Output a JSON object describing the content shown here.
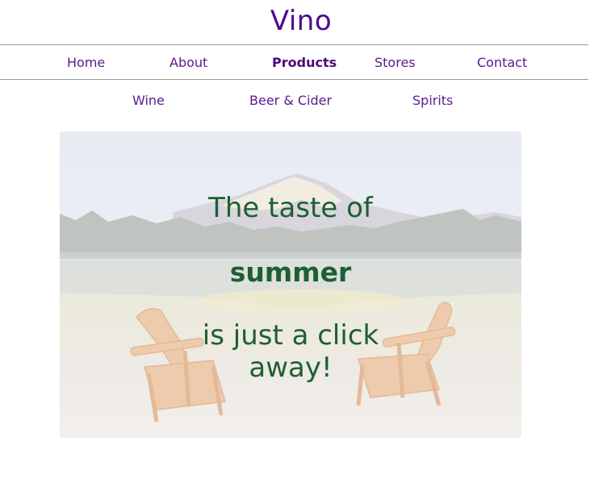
{
  "site": {
    "title": "Vino"
  },
  "main_nav": {
    "items": [
      {
        "label": "Home",
        "active": false
      },
      {
        "label": "About",
        "active": false
      },
      {
        "label": "Products",
        "active": true
      },
      {
        "label": "Stores",
        "active": false
      },
      {
        "label": "Contact",
        "active": false
      }
    ]
  },
  "sub_nav": {
    "items": [
      {
        "label": "Wine"
      },
      {
        "label": "Beer & Cider"
      },
      {
        "label": "Spirits"
      }
    ]
  },
  "hero": {
    "line1": "The taste of",
    "line2": "summer",
    "line3a": "is just a click",
    "line3b": "away!"
  },
  "colors": {
    "brand": "#4b0a8c",
    "nav_text": "#5a1a8f",
    "hero_text": "#1e5e34",
    "divider": "#9a9a9a"
  }
}
